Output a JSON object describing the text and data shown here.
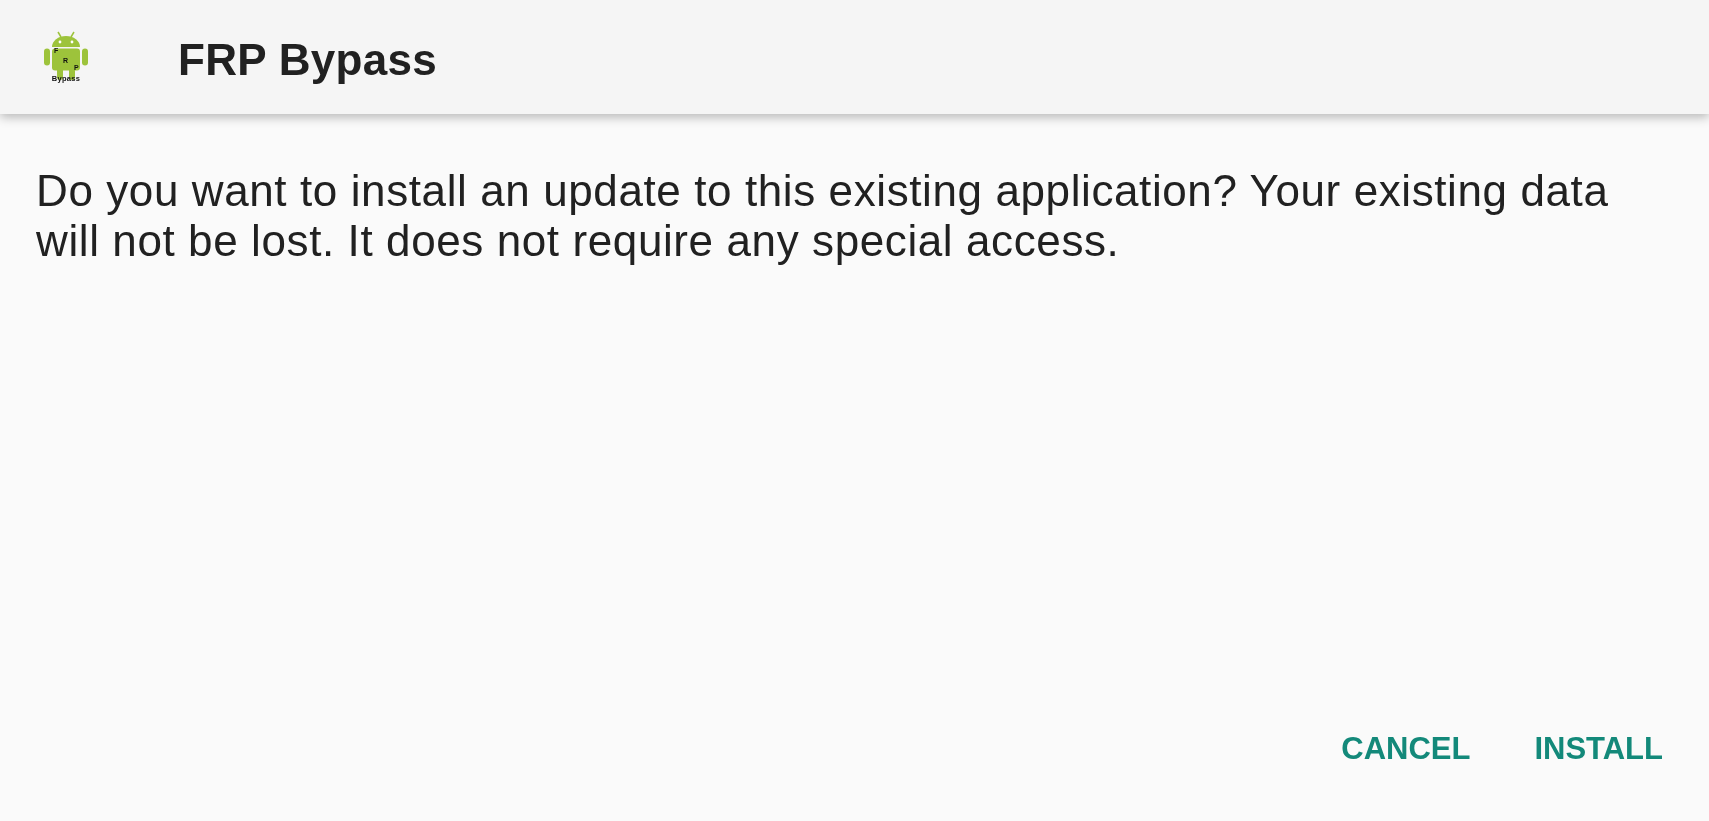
{
  "app_bar": {
    "logo": {
      "letters": [
        "F",
        "R",
        "P"
      ],
      "caption": "Bypass"
    },
    "title": "FRP Bypass"
  },
  "dialog": {
    "message": "Do you want to install an update to this existing application? Your existing data will not be lost. It does not require any special access."
  },
  "buttons": [
    {
      "label": "CANCEL"
    },
    {
      "label": "INSTALL"
    }
  ]
}
